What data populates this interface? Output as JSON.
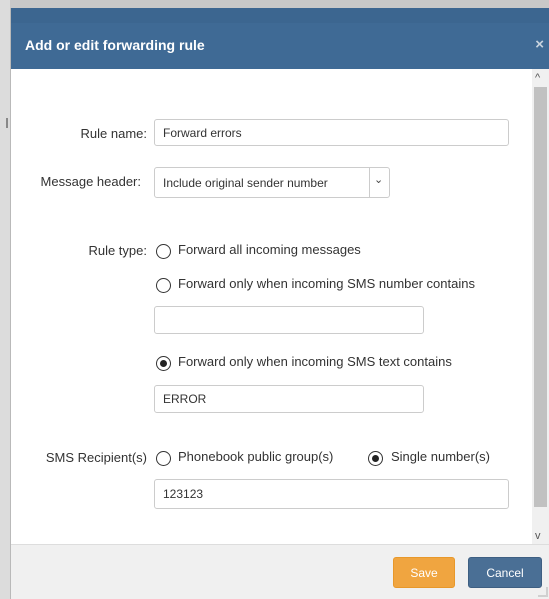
{
  "dialog": {
    "title": "Add or edit forwarding rule",
    "close_icon": "×"
  },
  "form": {
    "rule_name_label": "Rule name:",
    "rule_name_value": "Forward errors",
    "message_header_label": "Message header:",
    "message_header_value": "Include original sender number",
    "rule_type_label": "Rule type:",
    "rule_type_options": [
      {
        "label": "Forward all incoming messages",
        "checked": false
      },
      {
        "label": "Forward only when incoming SMS number contains",
        "checked": false
      },
      {
        "label": "Forward only when incoming SMS text contains",
        "checked": true
      }
    ],
    "number_contains_value": "",
    "text_contains_value": "ERROR",
    "recipients_label": "SMS Recipient(s)",
    "recipient_options": [
      {
        "label": "Phonebook public group(s)",
        "checked": false
      },
      {
        "label": "Single number(s)",
        "checked": true
      }
    ],
    "recipients_value": "123123"
  },
  "footer": {
    "save_label": "Save",
    "cancel_label": "Cancel"
  },
  "icons": {
    "scroll_up": "^",
    "scroll_down": "v",
    "select_arrow": "chevron-down-icon"
  },
  "colors": {
    "header": "#3f6a95",
    "save": "#f0a540",
    "cancel": "#4a6f95"
  }
}
